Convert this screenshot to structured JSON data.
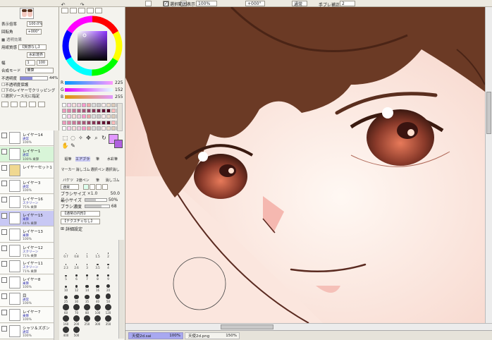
{
  "topbar": {
    "zoom": "100%",
    "angle": "+000°",
    "check_label": "選択範囲表示",
    "blend_label": "通常",
    "stabilizer_label": "手ブレ補正",
    "stabilizer_value": "2"
  },
  "left_panel": {
    "zoom_label": "表示倍率",
    "zoom_value": "100.0%",
    "angle_label": "回転角",
    "angle_value": "+000°",
    "paper_label": "用紙質感",
    "paper_value": "【質感なし】",
    "paper_effect": "水彩境界",
    "width_label": "幅",
    "width_value": "1",
    "strength_value": "100",
    "mode_label": "合成モード",
    "mode_value": "乗算",
    "opacity_label": "不透明度",
    "opacity_value": "44%",
    "chk1": "不透明度保護",
    "chk2": "下のレイヤーでクリッピング",
    "chk3": "選択ソース元に指定",
    "layers": [
      {
        "name": "レイヤー14",
        "mode": "通常",
        "opacity": "100%",
        "selected": false
      },
      {
        "name": "レイヤー1",
        "mode": "通常",
        "opacity": "100% 乗算",
        "selected": false,
        "green": true
      },
      {
        "name": "レイヤーセット1",
        "mode": "",
        "opacity": "",
        "selected": false,
        "folder": true
      },
      {
        "name": "レイヤー3",
        "mode": "通常",
        "opacity": "100%",
        "selected": false
      },
      {
        "name": "レイヤー16",
        "mode": "スクリーン",
        "opacity": "75% 乗算",
        "selected": false
      },
      {
        "name": "レイヤー15",
        "mode": "乗算",
        "opacity": "44% 乗算",
        "selected": true
      },
      {
        "name": "レイヤー13",
        "mode": "乗算",
        "opacity": "100%",
        "selected": false
      },
      {
        "name": "レイヤー12",
        "mode": "スクリーン",
        "opacity": "71% 乗算",
        "selected": false
      },
      {
        "name": "レイヤー11",
        "mode": "スクリーン",
        "opacity": "71% 乗算",
        "selected": false
      },
      {
        "name": "レイヤー8",
        "mode": "乗算",
        "opacity": "100%",
        "selected": false
      },
      {
        "name": "目",
        "mode": "通常",
        "opacity": "100%",
        "selected": false
      },
      {
        "name": "レイヤー7",
        "mode": "乗算",
        "opacity": "100%",
        "selected": false
      },
      {
        "name": "シャツ＆ズボン",
        "mode": "通常",
        "opacity": "100%",
        "selected": false
      }
    ]
  },
  "color": {
    "r_label": "R",
    "r_value": "225",
    "g_label": "G",
    "g_value": "152",
    "b_label": "B",
    "b_value": "255"
  },
  "tools": {
    "row1": [
      "鉛筆",
      "エアブラシ",
      "筆",
      "水彩筆"
    ],
    "row2": [
      "マーカー",
      "消しゴム",
      "選択ペン",
      "選択消し"
    ],
    "row3": [
      "バケツ",
      "2値ペン",
      "筆",
      "消しゴム"
    ]
  },
  "brush": {
    "mode": "通常",
    "size_label": "ブラシサイズ",
    "size_mult": "×1.0",
    "size_value": "50.0",
    "min_label": "最小サイズ",
    "min_value": "50%",
    "density_label": "ブラシ濃度",
    "density_value": "68",
    "shape_value": "【通常の円形】",
    "texture_value": "【テクスチャなし】",
    "detail_label": "詳細設定",
    "sizes": [
      "0.7",
      "0.8",
      "1",
      "1.5",
      "2",
      "2.3",
      "2.6",
      "3",
      "3.5",
      "4",
      "5",
      "6",
      "7",
      "8",
      "9",
      "10",
      "12",
      "14",
      "16",
      "20",
      "25",
      "30",
      "35",
      "40",
      "50",
      "60",
      "70",
      "80",
      "100",
      "120",
      "160",
      "200",
      "250",
      "300",
      "350",
      "400",
      "500"
    ]
  },
  "status": {
    "tab1_name": "天使2d.sai",
    "tab1_zoom": "100%",
    "tab2_name": "天使2d.png",
    "tab2_zoom": "150%"
  }
}
